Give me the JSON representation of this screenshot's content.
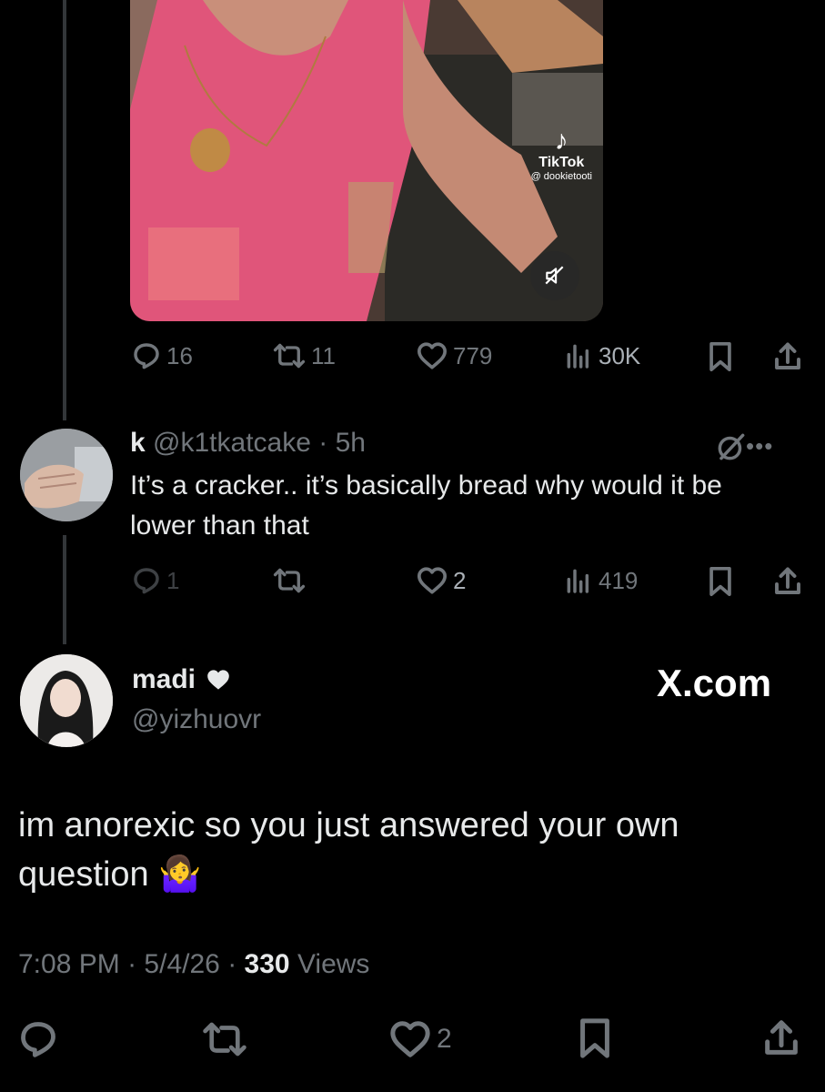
{
  "media": {
    "platform_label": "TikTok",
    "watermark_handle": "@ dookietooti",
    "mute_icon": "muted-speaker-icon"
  },
  "quoted_tweet_actions": {
    "replies": "16",
    "retweets": "11",
    "likes": "779",
    "views": "30K"
  },
  "reply": {
    "display_name": "k",
    "handle": "@k1tkatcake",
    "separator": "·",
    "time": "5h",
    "text": "It’s a cracker.. it’s basically bread why would it be lower than that",
    "actions": {
      "replies": "1",
      "retweets": "",
      "likes": "2",
      "views": "419"
    }
  },
  "main_tweet": {
    "display_name": "madi",
    "name_icon": "heart-icon",
    "handle": "@yizhuovr",
    "site_label": "X.com",
    "text": "im anorexic so you just answered your own question 🤷‍♀️",
    "time": "7:08 PM",
    "date": "5/4/26",
    "separator": "·",
    "views_count": "330",
    "views_label": "Views",
    "actions": {
      "likes": "2"
    }
  },
  "colors": {
    "background": "#000000",
    "text_primary": "#e7e9ea",
    "text_secondary": "#71767b",
    "thread_line": "#333639"
  }
}
